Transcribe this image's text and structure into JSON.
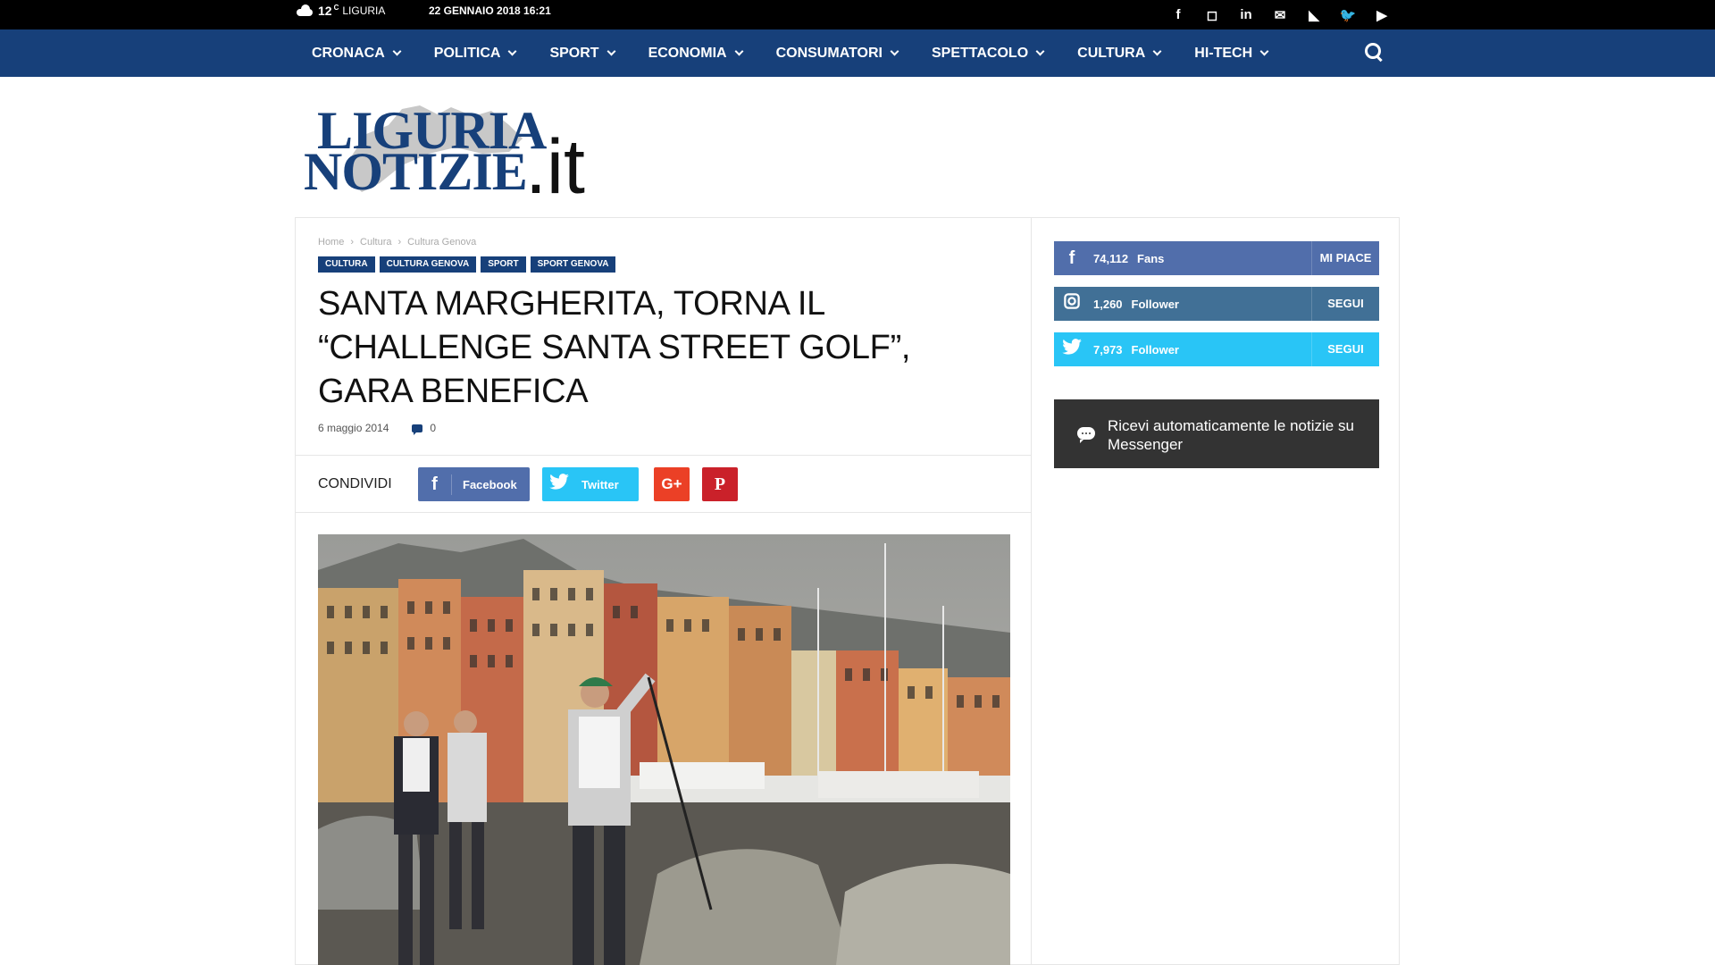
{
  "topbar": {
    "temperature": "12",
    "degree": "C",
    "location": "LIGURIA",
    "datetime": "22 GENNAIO 2018 16:21",
    "social_icons": [
      {
        "name": "facebook-icon",
        "glyph": "f"
      },
      {
        "name": "instagram-icon",
        "glyph": "◻"
      },
      {
        "name": "linkedin-icon",
        "glyph": "in"
      },
      {
        "name": "mail-icon",
        "glyph": "✉"
      },
      {
        "name": "rss-icon",
        "glyph": "◣"
      },
      {
        "name": "twitter-icon",
        "glyph": "🐦"
      },
      {
        "name": "youtube-icon",
        "glyph": "▶"
      }
    ]
  },
  "nav": {
    "items": [
      {
        "label": "CRONACA"
      },
      {
        "label": "POLITICA"
      },
      {
        "label": "SPORT"
      },
      {
        "label": "ECONOMIA"
      },
      {
        "label": "CONSUMATORI"
      },
      {
        "label": "SPETTACOLO"
      },
      {
        "label": "CULTURA"
      },
      {
        "label": "HI-TECH"
      }
    ]
  },
  "logo": {
    "line1": "LIGURIA",
    "line2": "NOTIZIE",
    "suffix": ".it"
  },
  "breadcrumb": {
    "items": [
      "Home",
      "Cultura",
      "Cultura Genova"
    ],
    "separator": "›"
  },
  "tags": [
    "CULTURA",
    "CULTURA GENOVA",
    "SPORT",
    "SPORT GENOVA"
  ],
  "article": {
    "title": "SANTA MARGHERITA, TORNA IL “CHALLENGE SANTA STREET GOLF”, GARA BENEFICA",
    "date": "6 maggio 2014",
    "comments": "0"
  },
  "share": {
    "label": "CONDIVIDI",
    "facebook": "Facebook",
    "twitter": "Twitter",
    "googleplus_glyph": "G+",
    "pinterest_glyph": "P"
  },
  "sidebar": {
    "facebook": {
      "count": "74,112",
      "unit": "Fans",
      "action": "MI PIACE"
    },
    "instagram": {
      "count": "1,260",
      "unit": "Follower",
      "action": "SEGUI"
    },
    "twitter": {
      "count": "7,973",
      "unit": "Follower",
      "action": "SEGUI"
    },
    "messenger": "Ricevi automaticamente le notizie su Messenger"
  },
  "colors": {
    "brand": "#17407a",
    "facebook": "#516eab",
    "instagram": "#417096",
    "twitter": "#29c5f6",
    "googleplus": "#eb4026",
    "pinterest": "#ca212a",
    "messenger_bg": "#333333"
  }
}
